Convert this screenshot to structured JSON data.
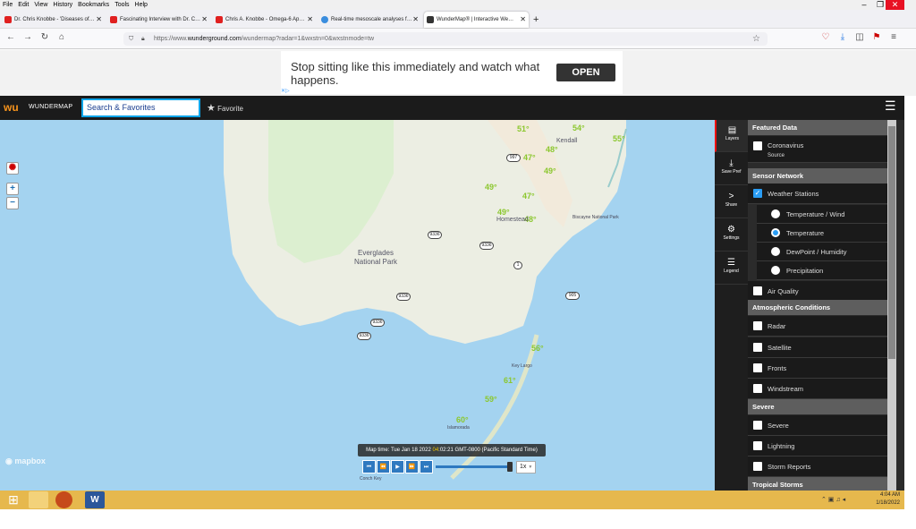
{
  "menubar": [
    "File",
    "Edit",
    "View",
    "History",
    "Bookmarks",
    "Tools",
    "Help"
  ],
  "tabs": [
    {
      "label": "Dr. Chris Knobbe - 'Diseases of…",
      "active": false,
      "color": "#e02020"
    },
    {
      "label": "Fascinating Interview with Dr. C…",
      "active": false,
      "color": "#e02020"
    },
    {
      "label": "Chris A. Knobbe - Omega-6 Ap…",
      "active": false,
      "color": "#e02020"
    },
    {
      "label": "Real-time mesoscale analyses f…",
      "active": false,
      "color": "#3a8dde"
    },
    {
      "label": "WunderMap® | Interactive We…",
      "active": true,
      "color": "#333"
    }
  ],
  "url": {
    "prefix": "https://www.",
    "host": "wunderground.com",
    "path": "/wundermap?radar=1&wxstn=0&wxstnmode=tw"
  },
  "ad": {
    "text": "Stop sitting like this immediately and watch what happens.",
    "button": "OPEN"
  },
  "wu": {
    "brand": "WUNDERMAP",
    "search": "Search & Favorites",
    "favorite": "Favorite"
  },
  "map": {
    "temps": [
      "51°",
      "49°",
      "54°",
      "48°",
      "47°",
      "49°",
      "49°",
      "47°",
      "48°",
      "55°",
      "56°",
      "61°",
      "59°",
      "60°"
    ],
    "highways": [
      "997",
      "9336",
      "9336",
      "1",
      "905",
      "9336",
      "9336",
      "9336"
    ],
    "labels": {
      "everglades": "Everglades National Park",
      "homestead": "Homestead",
      "kendall": "Kendall",
      "biscayne": "Biscayne National Park",
      "keylargo": "Key Largo",
      "islamorada": "Islamorada",
      "conch": "Conch Key"
    },
    "mapbox": "mapbox",
    "time_prefix": "Map time: Tue Jan 18 2022 ",
    "time_hour": "04",
    "time_suffix": ":02:21 GMT-0800 (Pacific Standard Time)",
    "speed": "1x"
  },
  "panel": {
    "tabs": [
      "Layers",
      "Save Pref",
      "Share",
      "Settings",
      "Legend"
    ],
    "featured": "Featured Data",
    "coronavirus": "Coronavirus",
    "source": "Source",
    "sensor": "Sensor Network",
    "stations": "Weather Stations",
    "opt_tempwind": "Temperature / Wind",
    "opt_temp": "Temperature",
    "opt_dew": "DewPoint / Humidity",
    "opt_precip": "Precipitation",
    "air": "Air Quality",
    "atmos": "Atmospheric Conditions",
    "radar": "Radar",
    "satellite": "Satellite",
    "fronts": "Fronts",
    "wind": "Windstream",
    "severe_hdr": "Severe",
    "severe": "Severe",
    "lightning": "Lightning",
    "storm": "Storm Reports",
    "tropical": "Tropical Storms"
  },
  "clock": {
    "time": "4:04 AM",
    "date": "1/18/2022"
  }
}
